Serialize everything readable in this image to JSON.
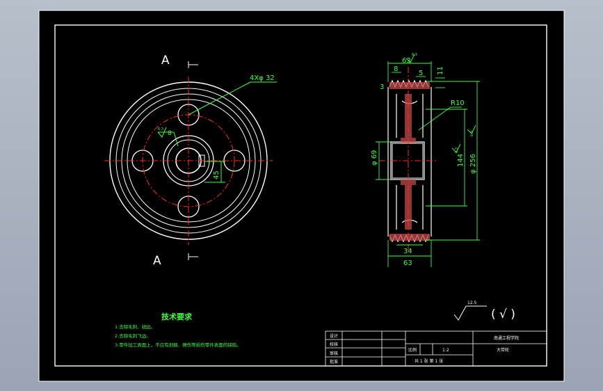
{
  "section_letters": {
    "top": "A",
    "bottom": "A"
  },
  "front_view": {
    "holes_note": "4Xφ 32",
    "roughness": "6.3",
    "roughness_value": "8",
    "keyway_dim": "45"
  },
  "side_view": {
    "dim_width_top": "63",
    "roughness_top": "6.3",
    "dim_groove": "8",
    "dim_five": "5",
    "dim_eleven": "11",
    "dim_three": "3",
    "radius": "R10",
    "dim_bore": "φ 69",
    "dim_hub": "144",
    "dim_outer": "φ 256",
    "roughness_right": "6.3",
    "roughness_left": "6.3",
    "dim_34": "34",
    "dim_63_bottom": "63"
  },
  "roughness_symbol": {
    "value": "12.5",
    "paren": "( √ )"
  },
  "tech_requirements": {
    "title": "技术要求",
    "items": [
      "1.去除毛刺、锐边。",
      "2.去除毛刺飞边。",
      "3.零件加工表面上，不应有划痕、擦伤等损伤零件表面的缺陷。"
    ]
  },
  "title_block": {
    "design": "设计",
    "check": "校核",
    "review": "审核",
    "approve": "批准",
    "school": "南通工程学院",
    "scale_label": "比例",
    "scale_value": "1:2",
    "part_name": "大带轮",
    "sheets": "共 1 张 第 1 张"
  }
}
